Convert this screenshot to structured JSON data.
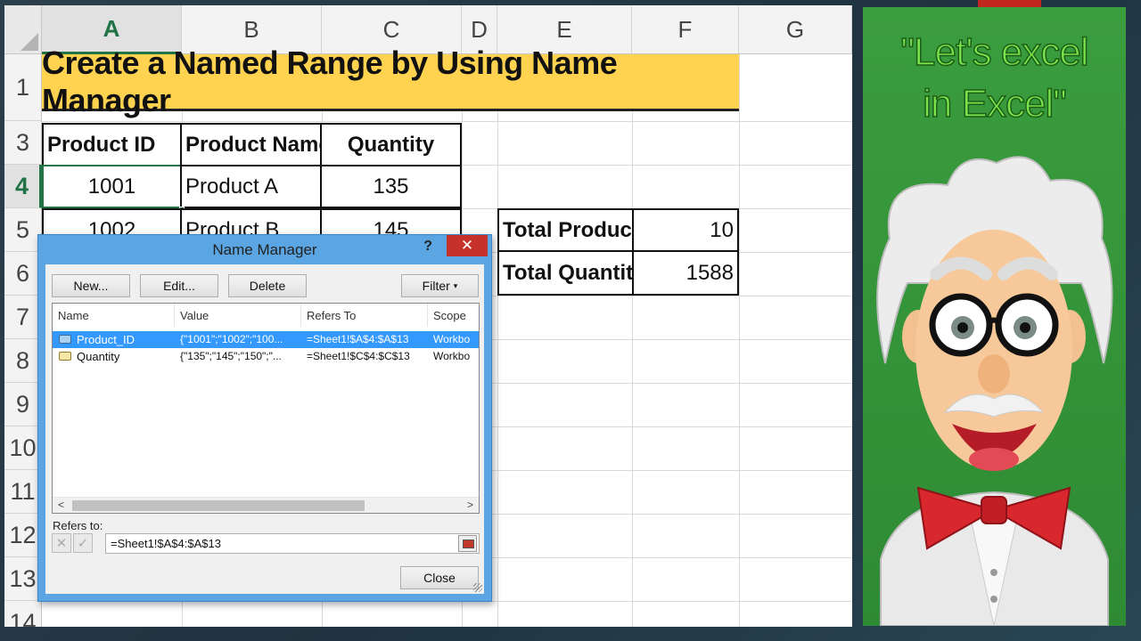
{
  "spreadsheet": {
    "columns": [
      "A",
      "B",
      "C",
      "D",
      "E",
      "F",
      "G"
    ],
    "rows": [
      "1",
      "3",
      "4",
      "5",
      "6",
      "7",
      "8",
      "9",
      "10",
      "11",
      "12",
      "13",
      "14"
    ],
    "title": "Create a Named Range by Using Name Manager",
    "table_headers": [
      "Product ID",
      "Product Name",
      "Quantity"
    ],
    "table_rows": [
      [
        "1001",
        "Product A",
        "135"
      ],
      [
        "1002",
        "Product B",
        "145"
      ]
    ],
    "summary": [
      {
        "label": "Total Products",
        "value": "10"
      },
      {
        "label": "Total Quantity",
        "value": "1588"
      }
    ],
    "selected_column": "A",
    "selected_row": "4",
    "grid_color": "#d9d9d9",
    "header_accent": "#217346",
    "title_fill": "#ffd34f"
  },
  "dialog": {
    "title": "Name Manager",
    "help": "?",
    "close_glyph": "✕",
    "buttons": {
      "new": "New...",
      "edit": "Edit...",
      "delete": "Delete",
      "filter": "Filter",
      "close": "Close"
    },
    "list_headers": [
      "Name",
      "Value",
      "Refers To",
      "Scope"
    ],
    "names": [
      {
        "name": "Product_ID",
        "value": "{\"1001\";\"1002\";\"100...",
        "refers_to": "=Sheet1!$A$4:$A$13",
        "scope": "Workbo",
        "selected": true
      },
      {
        "name": "Quantity",
        "value": "{\"135\";\"145\";\"150\";\"...",
        "refers_to": "=Sheet1!$C$4:$C$13",
        "scope": "Workbo",
        "selected": false
      }
    ],
    "refers_to_label": "Refers to:",
    "refers_to_value": "=Sheet1!$A$4:$A$13",
    "selection_color": "#3399ff",
    "title_bar_color": "#5aa5e2"
  },
  "brand_panel": {
    "slogan_line1": "\"Let's excel",
    "slogan_line2": "in Excel\"",
    "background": "#3a9d3e",
    "slogan_color": "#7ae24a"
  }
}
